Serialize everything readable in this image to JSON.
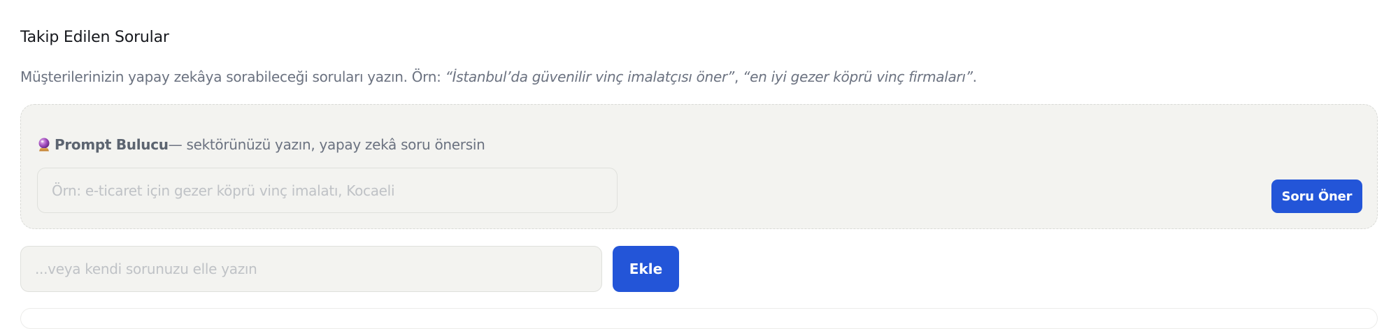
{
  "section": {
    "title": "Takip Edilen Sorular",
    "description_prefix": "Müşterilerinizin yapay zekâya sorabileceği soruları yazın. Örn: ",
    "example_1": "“İstanbul’da güvenilir vinç imalatçısı öner”",
    "separator": ", ",
    "example_2": "“en iyi gezer köprü vinç firmaları”",
    "description_suffix": "."
  },
  "prompt_finder": {
    "icon": "crystal-ball-icon",
    "title": "Prompt Bulucu",
    "subtitle": " — sektörünüzü yazın, yapay zekâ soru önersin",
    "input_value": "",
    "input_placeholder": "Örn: e-ticaret için gezer köprü vinç imalatı, Kocaeli",
    "button_label": "Soru Öner"
  },
  "manual_entry": {
    "input_value": "",
    "input_placeholder": "...veya kendi sorunuzu elle yazın",
    "button_label": "Ekle"
  },
  "colors": {
    "accent": "#2355d8",
    "panel_background": "#f3f3f0",
    "muted_text": "#6b7280"
  }
}
